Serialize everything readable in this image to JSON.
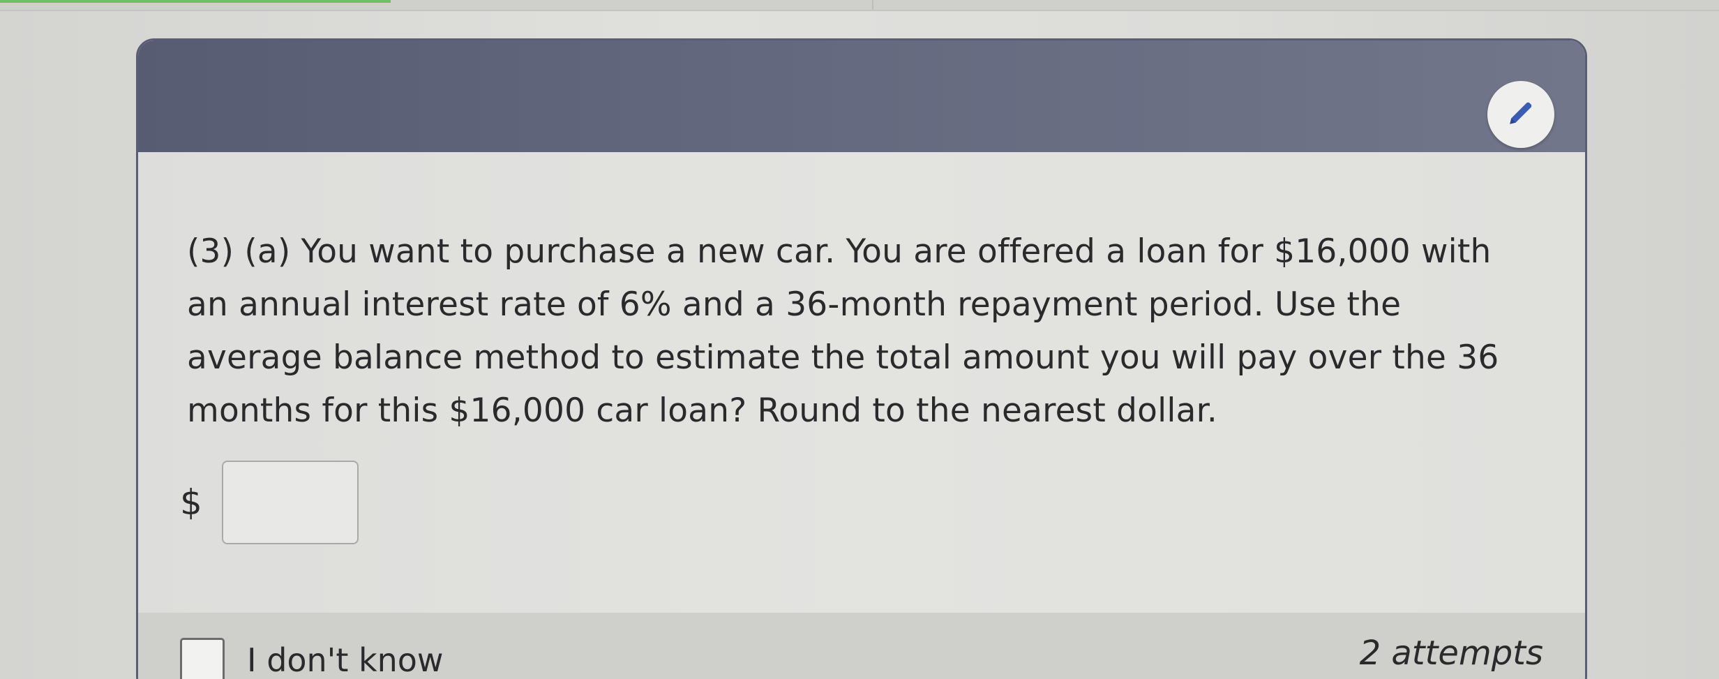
{
  "question": {
    "lines": [
      "(3) (a) You want to purchase a new car. You are offered a loan for $16,000 with",
      "an annual interest rate of 6% and a 36-month repayment period. Use the",
      "average balance method to estimate the total amount you will pay over the 36",
      "months for this $16,000 car loan? Round to the nearest dollar."
    ]
  },
  "answer": {
    "prefix": "$",
    "value": "",
    "placeholder": ""
  },
  "footer": {
    "dont_know_label": "I don't know",
    "attempts_label": "2 attempts"
  },
  "icons": {
    "edit": "pencil-icon"
  },
  "colors": {
    "header": "#5f6378",
    "edit_icon": "#3b5bb5"
  }
}
